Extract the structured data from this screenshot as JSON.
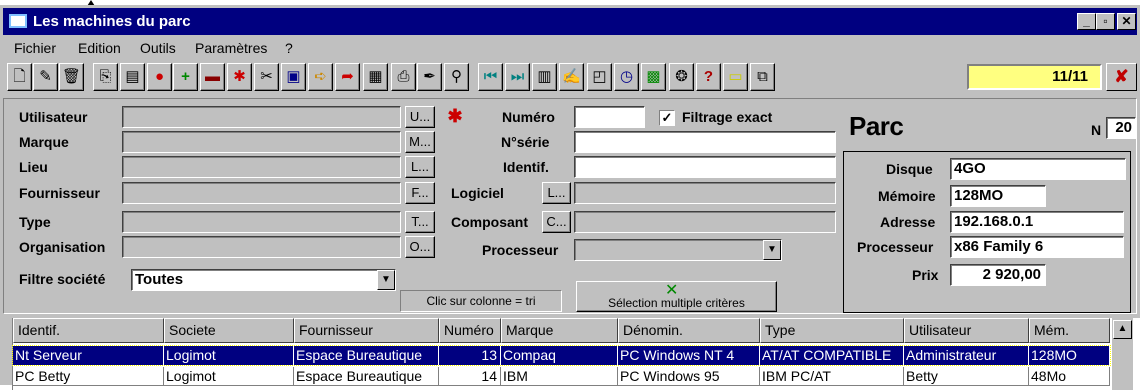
{
  "window": {
    "title": "Les machines du parc"
  },
  "menu": [
    "Fichier",
    "Edition",
    "Outils",
    "Paramètres",
    "?"
  ],
  "toolbar": {
    "counter": "11/11"
  },
  "filters": {
    "utilisateur_label": "Utilisateur",
    "marque_label": "Marque",
    "lieu_label": "Lieu",
    "fournisseur_label": "Fournisseur",
    "type_label": "Type",
    "organisation_label": "Organisation",
    "filtre_societe_label": "Filtre société",
    "filtre_societe_value": "Toutes",
    "btn_u": "U...",
    "btn_m": "M...",
    "btn_l": "L...",
    "btn_f": "F...",
    "btn_t": "T...",
    "btn_o": "O...",
    "numero_label": "Numéro",
    "filtrage_exact_label": "Filtrage exact",
    "nserie_label": "N°série",
    "identif_label": "Identif.",
    "logiciel_label": "Logiciel",
    "composant_label": "Composant",
    "processeur_label": "Processeur",
    "btn_logiciel": "L...",
    "btn_composant": "C...",
    "tri_hint": "Clic sur colonne = tri",
    "multi_select": "Sélection multiple critères"
  },
  "parc": {
    "title": "Parc",
    "n_label": "N",
    "n_value": "20",
    "disque_label": "Disque",
    "disque_value": "4GO",
    "memoire_label": "Mémoire",
    "memoire_value": "128MO",
    "adresse_label": "Adresse",
    "adresse_value": "192.168.0.1",
    "processeur_label": "Processeur",
    "processeur_value": "x86 Family 6",
    "prix_label": "Prix",
    "prix_value": "2 920,00"
  },
  "table": {
    "headers": [
      "Identif.",
      "Societe",
      "Fournisseur",
      "Numéro",
      "Marque",
      "Dénomin.",
      "Type",
      "Utilisateur",
      "Mém."
    ],
    "rows": [
      [
        "Nt Serveur",
        "Logimot",
        "Espace Bureautique",
        "13",
        "Compaq",
        "PC Windows NT 4",
        "AT/AT COMPATIBLE",
        "Administrateur",
        "128MO"
      ],
      [
        "PC Betty",
        "Logimot",
        "Espace Bureautique",
        "14",
        "IBM",
        "PC Windows 95",
        "IBM PC/AT",
        "Betty",
        "48Mo"
      ]
    ]
  },
  "colors": {
    "titlebar": "#000080",
    "face": "#c0c0c0",
    "counter": "#ffff80",
    "selection": "#000080"
  }
}
